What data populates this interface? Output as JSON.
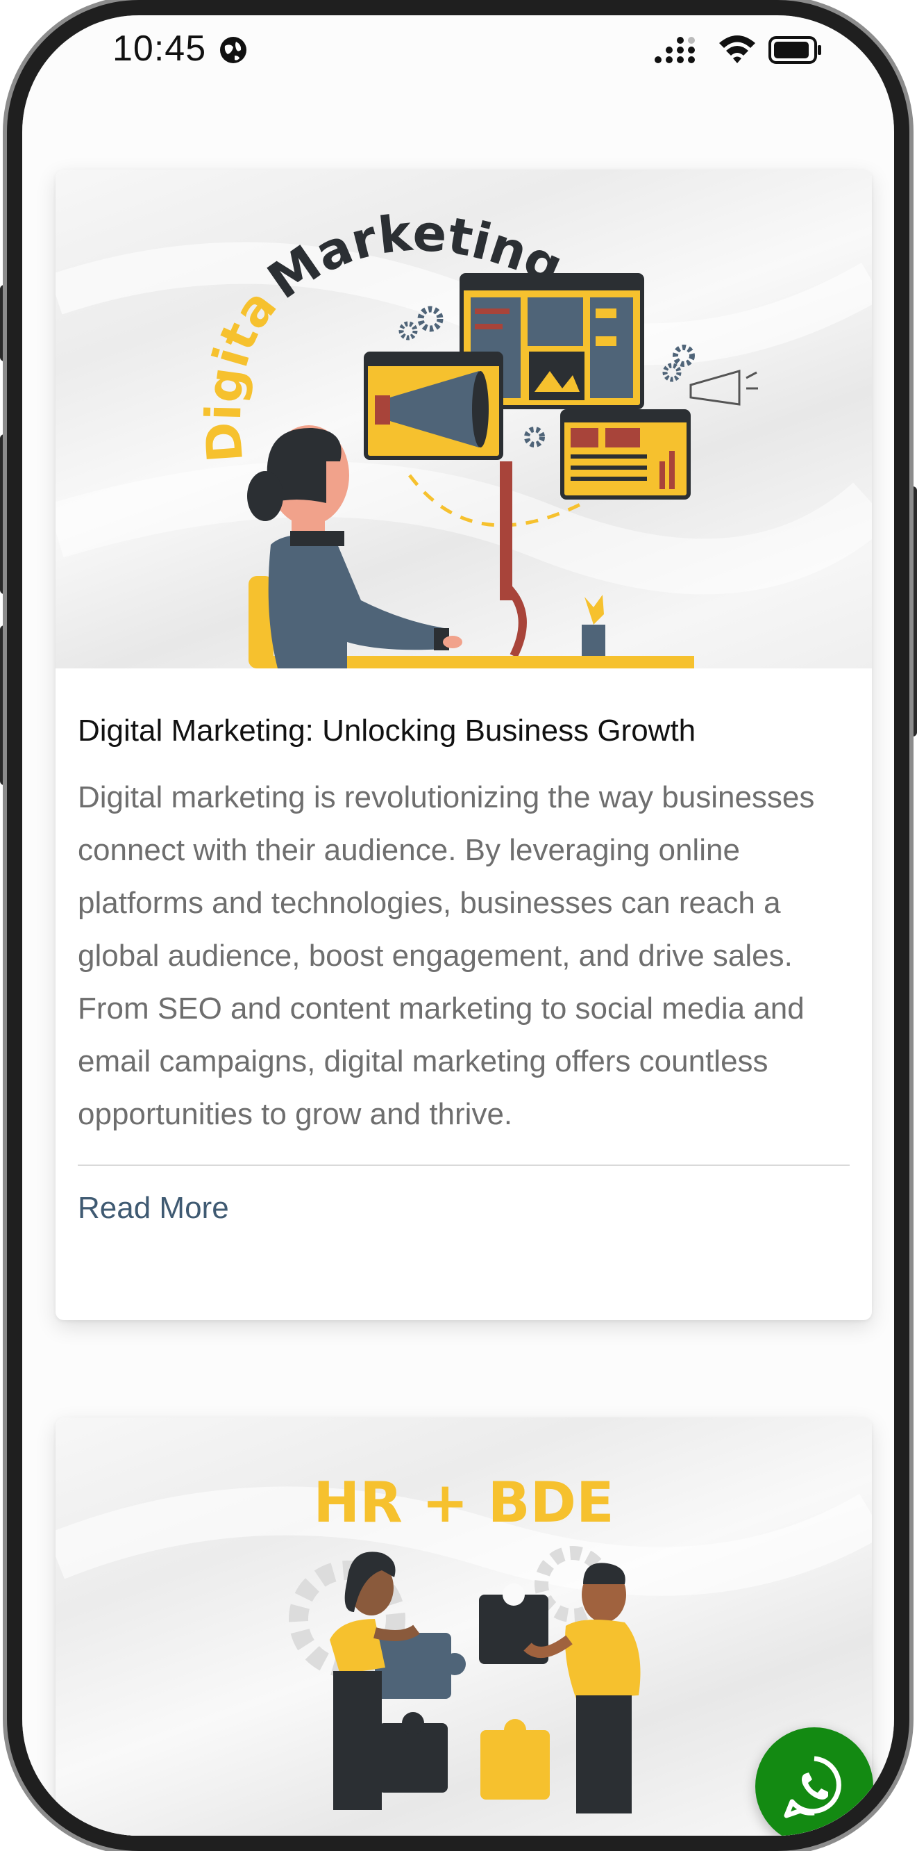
{
  "status_bar": {
    "time": "10:45",
    "icons": [
      "globe-icon",
      "cellular-signal-icon",
      "wifi-icon",
      "battery-icon"
    ]
  },
  "cards": [
    {
      "image": {
        "alt_icon": "digital-marketing-illustration",
        "headline_word1": "Digital",
        "headline_word2": "Marketing"
      },
      "title": "Digital Marketing: Unlocking Business Growth",
      "description": "Digital marketing is revolutionizing the way businesses connect with their audience. By leveraging online platforms and technologies, businesses can reach a global audience, boost engagement, and drive sales. From SEO and content marketing to social media and email campaigns, digital marketing offers countless opportunities to grow and thrive.",
      "link_label": "Read More"
    },
    {
      "image": {
        "alt_icon": "hr-bde-teamwork-illustration",
        "headline": "HR + BDE"
      }
    }
  ],
  "floating_button": {
    "icon": "whatsapp-icon"
  },
  "colors": {
    "accent_yellow": "#f6c12e",
    "slate": "#4f6478",
    "dark": "#2b2f33",
    "link": "#3f5a72",
    "whatsapp_green": "#138a12"
  }
}
